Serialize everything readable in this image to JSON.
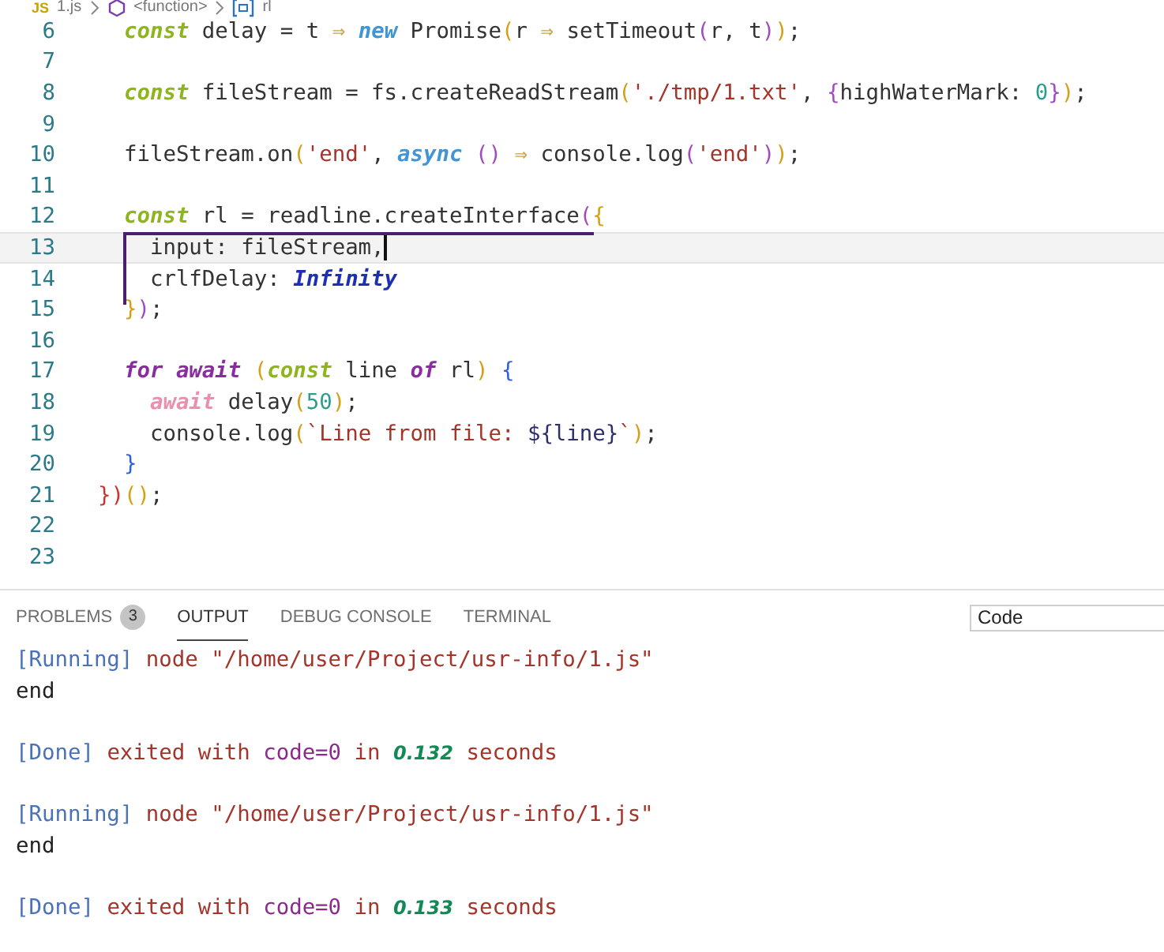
{
  "breadcrumb": {
    "items": [
      {
        "kind": "js",
        "badge": "JS",
        "text": "1.js"
      },
      {
        "kind": "function",
        "text": "<function>"
      },
      {
        "kind": "variable",
        "text": "rl"
      }
    ]
  },
  "editor": {
    "lines": [
      {
        "number": "6",
        "current": false,
        "tokens": [
          {
            "kind": "storage",
            "text": "  const"
          },
          {
            "kind": "plain",
            "text": " delay = t "
          },
          {
            "kind": "arrow",
            "text": "⇒"
          },
          {
            "kind": "new",
            "text": " new"
          },
          {
            "kind": "plain",
            "text": " Promise"
          },
          {
            "kind": "bracket1",
            "text": "("
          },
          {
            "kind": "plain",
            "text": "r "
          },
          {
            "kind": "arrow",
            "text": "⇒"
          },
          {
            "kind": "plain",
            "text": " setTimeout"
          },
          {
            "kind": "bracket2",
            "text": "("
          },
          {
            "kind": "plain",
            "text": "r, t"
          },
          {
            "kind": "bracket2",
            "text": ")"
          },
          {
            "kind": "bracket1",
            "text": ")"
          },
          {
            "kind": "plain",
            "text": ";"
          }
        ]
      },
      {
        "number": "7",
        "current": false
      },
      {
        "number": "8",
        "current": false,
        "tokens": [
          {
            "kind": "storage",
            "text": "  const"
          },
          {
            "kind": "plain",
            "text": " fileStream = fs.createReadStream"
          },
          {
            "kind": "bracket1",
            "text": "("
          },
          {
            "kind": "string",
            "text": "'./tmp/1.txt'"
          },
          {
            "kind": "plain",
            "text": ", "
          },
          {
            "kind": "bracket2",
            "text": "{"
          },
          {
            "kind": "plain",
            "text": "highWaterMark: "
          },
          {
            "kind": "number",
            "text": "0"
          },
          {
            "kind": "bracket2",
            "text": "}"
          },
          {
            "kind": "bracket1",
            "text": ")"
          },
          {
            "kind": "plain",
            "text": ";"
          }
        ]
      },
      {
        "number": "9",
        "current": false
      },
      {
        "number": "10",
        "current": false,
        "tokens": [
          {
            "kind": "plain",
            "text": "  fileStream.on"
          },
          {
            "kind": "bracket1",
            "text": "("
          },
          {
            "kind": "string",
            "text": "'end'"
          },
          {
            "kind": "plain",
            "text": ", "
          },
          {
            "kind": "new",
            "text": "async"
          },
          {
            "kind": "bracket2",
            "text": " ()"
          },
          {
            "kind": "arrow",
            "text": " ⇒"
          },
          {
            "kind": "plain",
            "text": " console.log"
          },
          {
            "kind": "bracket2",
            "text": "("
          },
          {
            "kind": "string",
            "text": "'end'"
          },
          {
            "kind": "bracket2",
            "text": ")"
          },
          {
            "kind": "bracket1",
            "text": ")"
          },
          {
            "kind": "plain",
            "text": ";"
          }
        ]
      },
      {
        "number": "11",
        "current": false
      },
      {
        "number": "12",
        "current": false,
        "tokens": [
          {
            "kind": "storage",
            "text": "  const"
          },
          {
            "kind": "plain",
            "text": " rl = readline.createInterface"
          },
          {
            "kind": "bracket2",
            "text": "("
          },
          {
            "kind": "bracket1",
            "text": "{"
          }
        ]
      },
      {
        "number": "13",
        "current": true,
        "tokens": [
          {
            "kind": "plain",
            "text": "    input: fileStream,"
          }
        ]
      },
      {
        "number": "14",
        "current": false,
        "tokens": [
          {
            "kind": "plain",
            "text": "    crlfDelay: "
          },
          {
            "kind": "constant",
            "text": "Infinity"
          }
        ]
      },
      {
        "number": "15",
        "current": false,
        "tokens": [
          {
            "kind": "bracket1",
            "text": "  }"
          },
          {
            "kind": "bracket2",
            "text": ")"
          },
          {
            "kind": "plain",
            "text": ";"
          }
        ]
      },
      {
        "number": "16",
        "current": false
      },
      {
        "number": "17",
        "current": false,
        "tokens": [
          {
            "kind": "control",
            "text": "  for await"
          },
          {
            "kind": "bracket1",
            "text": " ("
          },
          {
            "kind": "storage",
            "text": "const"
          },
          {
            "kind": "plain",
            "text": " line "
          },
          {
            "kind": "control",
            "text": "of"
          },
          {
            "kind": "plain",
            "text": " rl"
          },
          {
            "kind": "bracket1",
            "text": ")"
          },
          {
            "kind": "bracket3",
            "text": " {"
          }
        ]
      },
      {
        "number": "18",
        "current": false,
        "tokens": [
          {
            "kind": "await",
            "text": "    await"
          },
          {
            "kind": "plain",
            "text": " delay"
          },
          {
            "kind": "bracket1",
            "text": "("
          },
          {
            "kind": "number",
            "text": "50"
          },
          {
            "kind": "bracket1",
            "text": ")"
          },
          {
            "kind": "plain",
            "text": ";"
          }
        ]
      },
      {
        "number": "19",
        "current": false,
        "tokens": [
          {
            "kind": "plain",
            "text": "    console.log"
          },
          {
            "kind": "bracket1",
            "text": "("
          },
          {
            "kind": "string",
            "text": "`Line from file: "
          },
          {
            "kind": "interp",
            "text": "${line}"
          },
          {
            "kind": "string",
            "text": "`"
          },
          {
            "kind": "bracket1",
            "text": ")"
          },
          {
            "kind": "plain",
            "text": ";"
          }
        ]
      },
      {
        "number": "20",
        "current": false,
        "tokens": [
          {
            "kind": "bracket3",
            "text": "  }"
          }
        ]
      },
      {
        "number": "21",
        "current": false,
        "tokens": [
          {
            "kind": "bracket0",
            "text": "})"
          },
          {
            "kind": "bracket1",
            "text": "()"
          },
          {
            "kind": "plain",
            "text": ";"
          }
        ]
      },
      {
        "number": "22",
        "current": false
      },
      {
        "number": "23",
        "current": false
      }
    ]
  },
  "panel": {
    "tabs": [
      {
        "label": "PROBLEMS",
        "badge": "3",
        "selected": false
      },
      {
        "label": "OUTPUT",
        "selected": true
      },
      {
        "label": "DEBUG CONSOLE",
        "selected": false
      },
      {
        "label": "TERMINAL",
        "selected": false
      }
    ],
    "channel_select": {
      "value": "Code"
    },
    "output_blocks": [
      {
        "lines": [
          {
            "tokens": [
              {
                "kind": "tag",
                "text": "[Running]"
              },
              {
                "kind": "message",
                "text": " node \"/home/user/Project/usr-info/1.js\""
              }
            ]
          },
          {
            "tokens": [
              {
                "kind": "plain",
                "text": "end"
              }
            ]
          }
        ]
      },
      {
        "lines": [
          {
            "tokens": [
              {
                "kind": "tag",
                "text": "[Done]"
              },
              {
                "kind": "message",
                "text": " exited with "
              },
              {
                "kind": "code",
                "text": "code=0"
              },
              {
                "kind": "message",
                "text": " in "
              },
              {
                "kind": "number",
                "text": "0.132"
              },
              {
                "kind": "message",
                "text": " seconds"
              }
            ]
          }
        ]
      },
      {
        "lines": [
          {
            "tokens": [
              {
                "kind": "tag",
                "text": "[Running]"
              },
              {
                "kind": "message",
                "text": " node \"/home/user/Project/usr-info/1.js\""
              }
            ]
          },
          {
            "tokens": [
              {
                "kind": "plain",
                "text": "end"
              }
            ]
          }
        ]
      },
      {
        "lines": [
          {
            "tokens": [
              {
                "kind": "tag",
                "text": "[Done]"
              },
              {
                "kind": "message",
                "text": " exited with "
              },
              {
                "kind": "code",
                "text": "code=0"
              },
              {
                "kind": "message",
                "text": " in "
              },
              {
                "kind": "number",
                "text": "0.133"
              },
              {
                "kind": "message",
                "text": " seconds"
              }
            ]
          }
        ]
      }
    ]
  }
}
